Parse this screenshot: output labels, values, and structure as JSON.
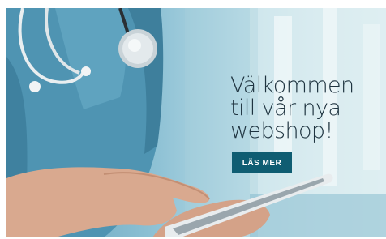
{
  "hero": {
    "headline_lines": [
      "Välkommen",
      "till vår nya",
      "webshop!"
    ],
    "cta_label": "LÄS MER"
  },
  "colors": {
    "cta_background": "#0f5d72",
    "headline_text": "#1f3440",
    "scrub_blue": "#5d9db8"
  },
  "icons": {
    "stethoscope": "stethoscope-illustration",
    "tablet": "tablet-illustration"
  }
}
